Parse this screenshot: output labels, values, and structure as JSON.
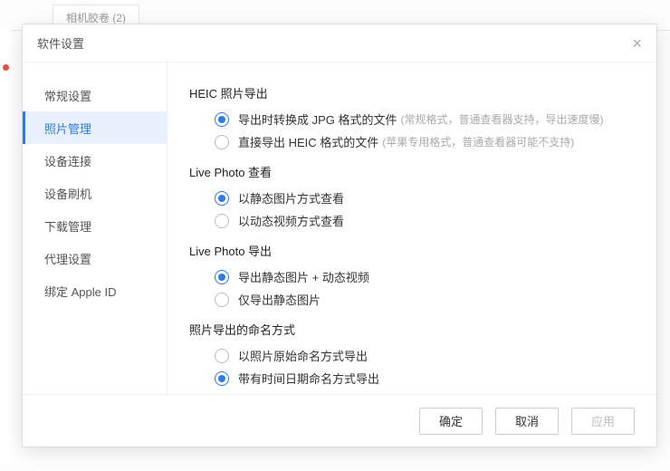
{
  "background": {
    "tab_label": "相机胶卷 (2)"
  },
  "dialog": {
    "title": "软件设置"
  },
  "sidebar": {
    "items": [
      {
        "label": "常规设置"
      },
      {
        "label": "照片管理"
      },
      {
        "label": "设备连接"
      },
      {
        "label": "设备刷机"
      },
      {
        "label": "下载管理"
      },
      {
        "label": "代理设置"
      },
      {
        "label": "绑定 Apple ID"
      }
    ],
    "active_index": 1
  },
  "sections": {
    "heic": {
      "title": "HEIC 照片导出",
      "opt1_label": "导出时转换成 JPG 格式的文件",
      "opt1_hint": "(常规格式，普通查看器支持，导出速度慢)",
      "opt2_label": "直接导出 HEIC 格式的文件",
      "opt2_hint": "(苹果专用格式，普通查看器可能不支持)",
      "selected": 0
    },
    "live_view": {
      "title": "Live Photo 查看",
      "opt1_label": "以静态图片方式查看",
      "opt2_label": "以动态视频方式查看",
      "selected": 0
    },
    "live_export": {
      "title": "Live Photo 导出",
      "opt1_label": "导出静态图片 + 动态视频",
      "opt2_label": "仅导出静态图片",
      "selected": 0
    },
    "naming": {
      "title": "照片导出的命名方式",
      "opt1_label": "以照片原始命名方式导出",
      "opt2_label": "带有时间日期命名方式导出",
      "selected": 1
    }
  },
  "footer": {
    "ok": "确定",
    "cancel": "取消",
    "apply": "应用"
  }
}
